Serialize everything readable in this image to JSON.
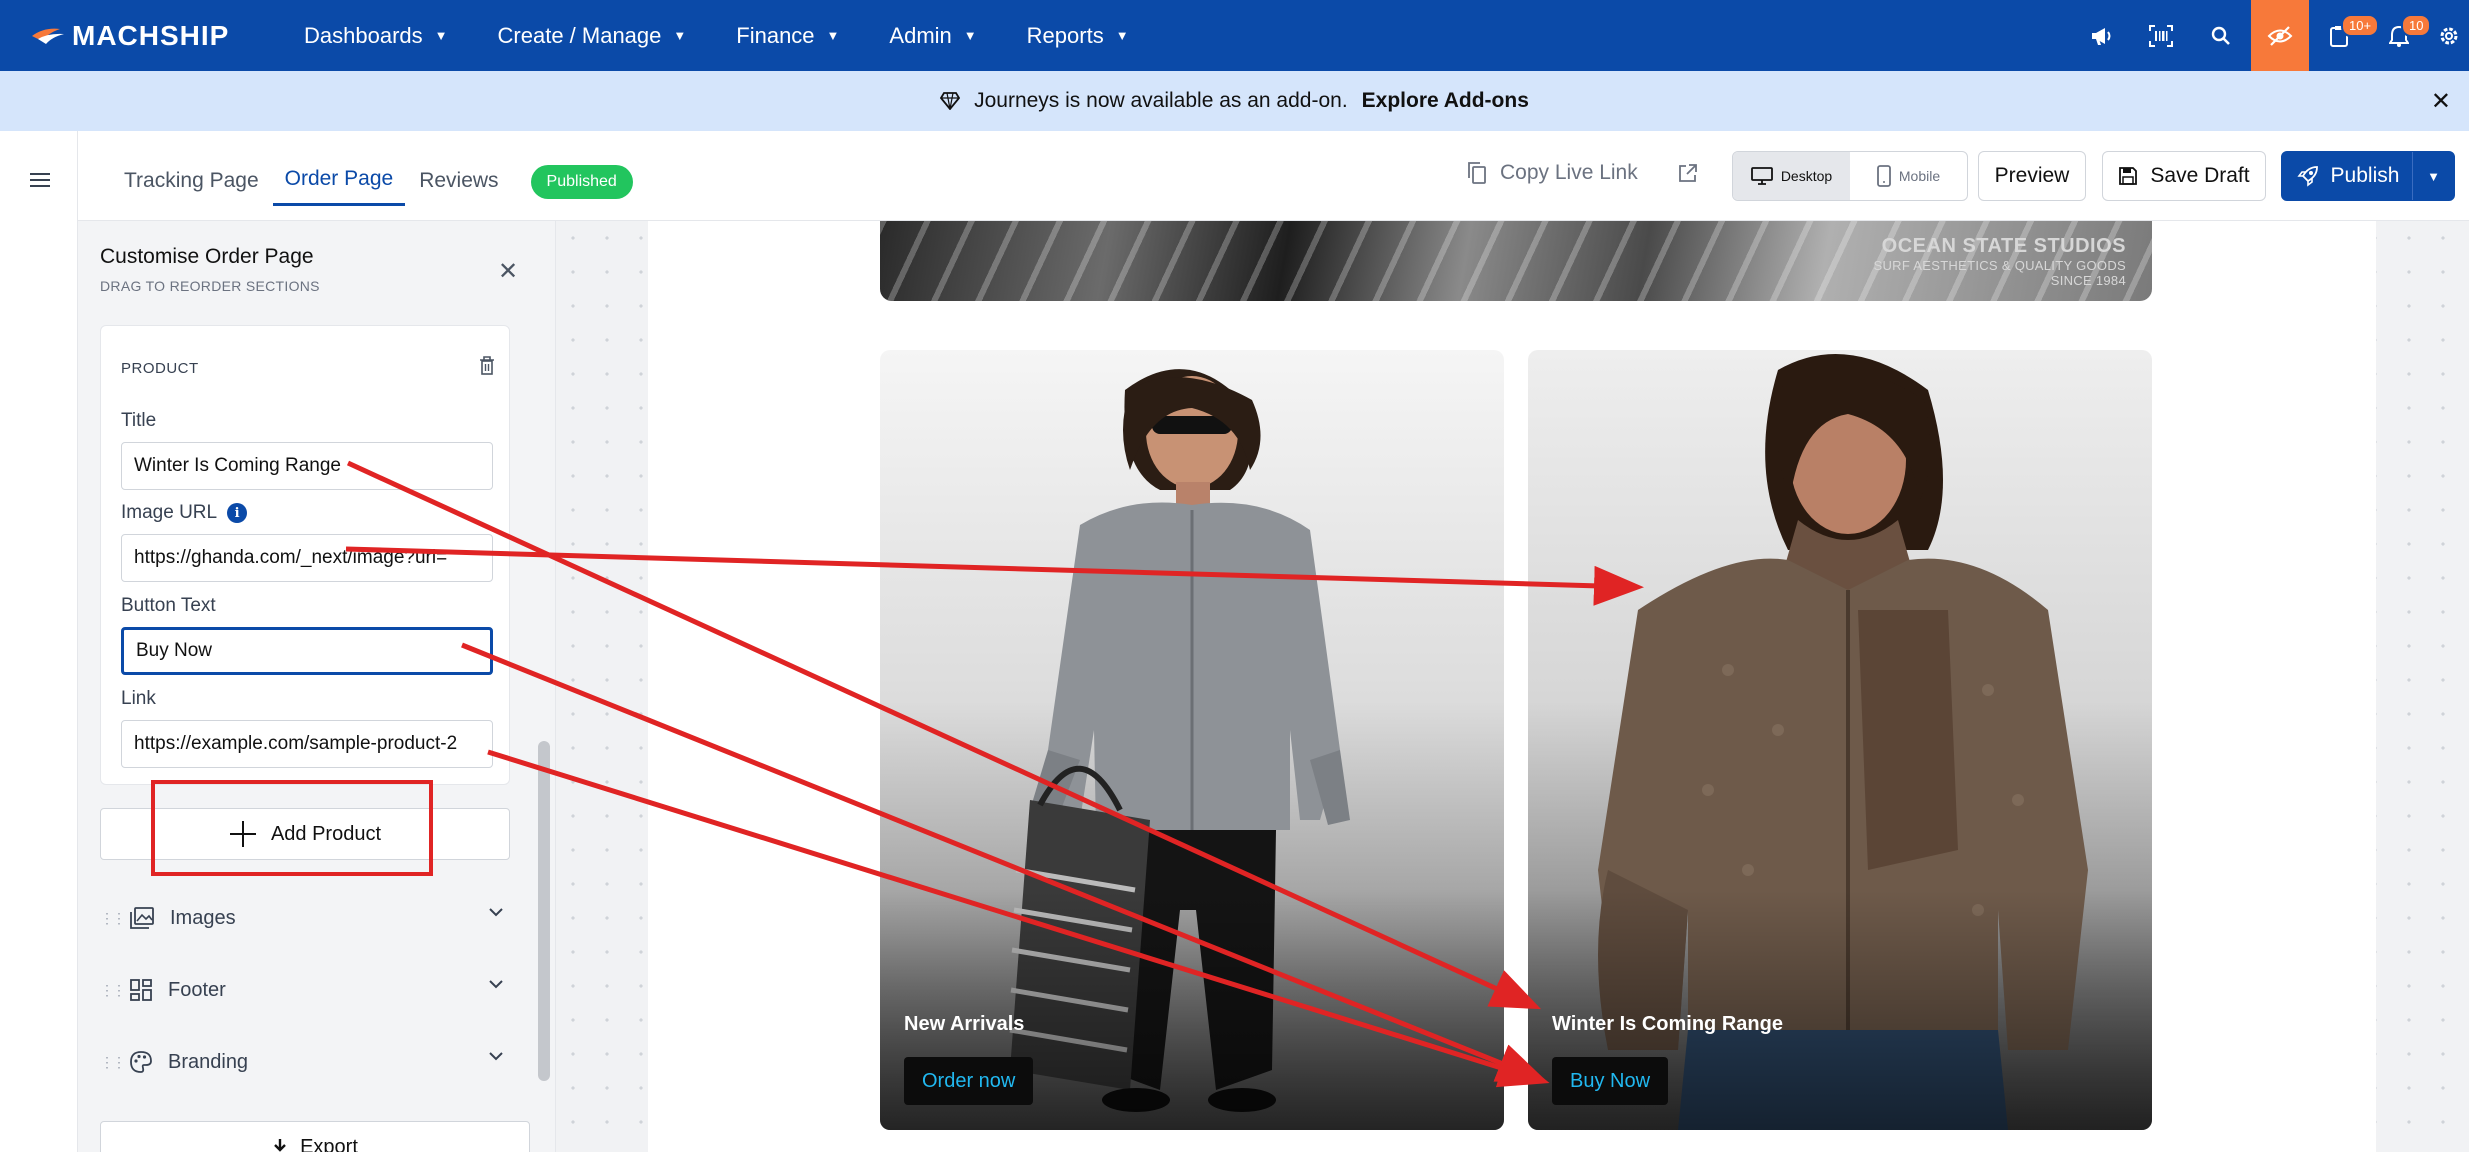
{
  "brand": {
    "name": "MACHSHIP"
  },
  "nav": {
    "items": [
      {
        "label": "Dashboards"
      },
      {
        "label": "Create / Manage"
      },
      {
        "label": "Finance"
      },
      {
        "label": "Admin"
      },
      {
        "label": "Reports"
      }
    ],
    "badges": {
      "tasks": "10+",
      "notifications": "10"
    }
  },
  "banner": {
    "message": "Journeys is now available as an add-on.",
    "link": "Explore Add-ons"
  },
  "editor": {
    "tabs": [
      {
        "label": "Tracking Page"
      },
      {
        "label": "Order Page"
      },
      {
        "label": "Reviews"
      }
    ],
    "active_tab": "Order Page",
    "status": "Published",
    "copy_link": "Copy Live Link",
    "devices": {
      "desktop": "Desktop",
      "mobile": "Mobile",
      "active": "Desktop"
    },
    "preview": "Preview",
    "save_draft": "Save Draft",
    "publish": "Publish"
  },
  "panel": {
    "title": "Customise Order Page",
    "subtitle": "DRAG TO REORDER SECTIONS",
    "product_card": {
      "heading": "PRODUCT",
      "title_label": "Title",
      "title_value": "Winter Is Coming Range",
      "image_label": "Image URL",
      "image_value": "https://ghanda.com/_next/image?url=",
      "button_label": "Button Text",
      "button_value": "Buy Now",
      "link_label": "Link",
      "link_value": "https://example.com/sample-product-2"
    },
    "add_product": "Add Product",
    "sections": [
      {
        "label": "Images"
      },
      {
        "label": "Footer"
      },
      {
        "label": "Branding"
      }
    ],
    "export": "Export"
  },
  "preview": {
    "hero": {
      "line1": "OCEAN STATE STUDIOS",
      "line2": "SURF AESTHETICS & QUALITY GOODS",
      "line3": "SINCE 1984"
    },
    "products": [
      {
        "title": "New Arrivals",
        "button": "Order now"
      },
      {
        "title": "Winter Is Coming Range",
        "button": "Buy Now"
      }
    ]
  },
  "colors": {
    "brand": "#0b4aa8",
    "accent": "#f7793a",
    "published": "#22c55e",
    "annotation": "#e02424",
    "cta_text": "#21b8f0"
  }
}
